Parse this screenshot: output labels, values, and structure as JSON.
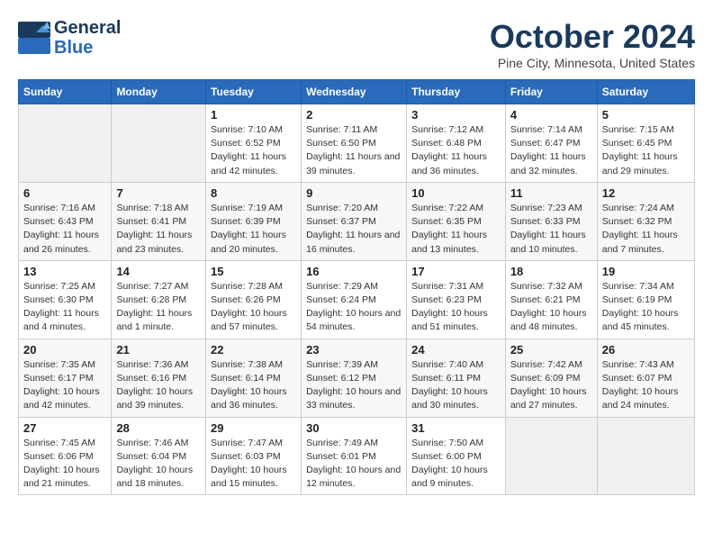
{
  "header": {
    "logo_general": "General",
    "logo_blue": "Blue",
    "month": "October 2024",
    "location": "Pine City, Minnesota, United States"
  },
  "weekdays": [
    "Sunday",
    "Monday",
    "Tuesday",
    "Wednesday",
    "Thursday",
    "Friday",
    "Saturday"
  ],
  "weeks": [
    [
      {
        "day": "",
        "empty": true
      },
      {
        "day": "",
        "empty": true
      },
      {
        "day": "1",
        "sunrise": "Sunrise: 7:10 AM",
        "sunset": "Sunset: 6:52 PM",
        "daylight": "Daylight: 11 hours and 42 minutes."
      },
      {
        "day": "2",
        "sunrise": "Sunrise: 7:11 AM",
        "sunset": "Sunset: 6:50 PM",
        "daylight": "Daylight: 11 hours and 39 minutes."
      },
      {
        "day": "3",
        "sunrise": "Sunrise: 7:12 AM",
        "sunset": "Sunset: 6:48 PM",
        "daylight": "Daylight: 11 hours and 36 minutes."
      },
      {
        "day": "4",
        "sunrise": "Sunrise: 7:14 AM",
        "sunset": "Sunset: 6:47 PM",
        "daylight": "Daylight: 11 hours and 32 minutes."
      },
      {
        "day": "5",
        "sunrise": "Sunrise: 7:15 AM",
        "sunset": "Sunset: 6:45 PM",
        "daylight": "Daylight: 11 hours and 29 minutes."
      }
    ],
    [
      {
        "day": "6",
        "sunrise": "Sunrise: 7:16 AM",
        "sunset": "Sunset: 6:43 PM",
        "daylight": "Daylight: 11 hours and 26 minutes."
      },
      {
        "day": "7",
        "sunrise": "Sunrise: 7:18 AM",
        "sunset": "Sunset: 6:41 PM",
        "daylight": "Daylight: 11 hours and 23 minutes."
      },
      {
        "day": "8",
        "sunrise": "Sunrise: 7:19 AM",
        "sunset": "Sunset: 6:39 PM",
        "daylight": "Daylight: 11 hours and 20 minutes."
      },
      {
        "day": "9",
        "sunrise": "Sunrise: 7:20 AM",
        "sunset": "Sunset: 6:37 PM",
        "daylight": "Daylight: 11 hours and 16 minutes."
      },
      {
        "day": "10",
        "sunrise": "Sunrise: 7:22 AM",
        "sunset": "Sunset: 6:35 PM",
        "daylight": "Daylight: 11 hours and 13 minutes."
      },
      {
        "day": "11",
        "sunrise": "Sunrise: 7:23 AM",
        "sunset": "Sunset: 6:33 PM",
        "daylight": "Daylight: 11 hours and 10 minutes."
      },
      {
        "day": "12",
        "sunrise": "Sunrise: 7:24 AM",
        "sunset": "Sunset: 6:32 PM",
        "daylight": "Daylight: 11 hours and 7 minutes."
      }
    ],
    [
      {
        "day": "13",
        "sunrise": "Sunrise: 7:25 AM",
        "sunset": "Sunset: 6:30 PM",
        "daylight": "Daylight: 11 hours and 4 minutes."
      },
      {
        "day": "14",
        "sunrise": "Sunrise: 7:27 AM",
        "sunset": "Sunset: 6:28 PM",
        "daylight": "Daylight: 11 hours and 1 minute."
      },
      {
        "day": "15",
        "sunrise": "Sunrise: 7:28 AM",
        "sunset": "Sunset: 6:26 PM",
        "daylight": "Daylight: 10 hours and 57 minutes."
      },
      {
        "day": "16",
        "sunrise": "Sunrise: 7:29 AM",
        "sunset": "Sunset: 6:24 PM",
        "daylight": "Daylight: 10 hours and 54 minutes."
      },
      {
        "day": "17",
        "sunrise": "Sunrise: 7:31 AM",
        "sunset": "Sunset: 6:23 PM",
        "daylight": "Daylight: 10 hours and 51 minutes."
      },
      {
        "day": "18",
        "sunrise": "Sunrise: 7:32 AM",
        "sunset": "Sunset: 6:21 PM",
        "daylight": "Daylight: 10 hours and 48 minutes."
      },
      {
        "day": "19",
        "sunrise": "Sunrise: 7:34 AM",
        "sunset": "Sunset: 6:19 PM",
        "daylight": "Daylight: 10 hours and 45 minutes."
      }
    ],
    [
      {
        "day": "20",
        "sunrise": "Sunrise: 7:35 AM",
        "sunset": "Sunset: 6:17 PM",
        "daylight": "Daylight: 10 hours and 42 minutes."
      },
      {
        "day": "21",
        "sunrise": "Sunrise: 7:36 AM",
        "sunset": "Sunset: 6:16 PM",
        "daylight": "Daylight: 10 hours and 39 minutes."
      },
      {
        "day": "22",
        "sunrise": "Sunrise: 7:38 AM",
        "sunset": "Sunset: 6:14 PM",
        "daylight": "Daylight: 10 hours and 36 minutes."
      },
      {
        "day": "23",
        "sunrise": "Sunrise: 7:39 AM",
        "sunset": "Sunset: 6:12 PM",
        "daylight": "Daylight: 10 hours and 33 minutes."
      },
      {
        "day": "24",
        "sunrise": "Sunrise: 7:40 AM",
        "sunset": "Sunset: 6:11 PM",
        "daylight": "Daylight: 10 hours and 30 minutes."
      },
      {
        "day": "25",
        "sunrise": "Sunrise: 7:42 AM",
        "sunset": "Sunset: 6:09 PM",
        "daylight": "Daylight: 10 hours and 27 minutes."
      },
      {
        "day": "26",
        "sunrise": "Sunrise: 7:43 AM",
        "sunset": "Sunset: 6:07 PM",
        "daylight": "Daylight: 10 hours and 24 minutes."
      }
    ],
    [
      {
        "day": "27",
        "sunrise": "Sunrise: 7:45 AM",
        "sunset": "Sunset: 6:06 PM",
        "daylight": "Daylight: 10 hours and 21 minutes."
      },
      {
        "day": "28",
        "sunrise": "Sunrise: 7:46 AM",
        "sunset": "Sunset: 6:04 PM",
        "daylight": "Daylight: 10 hours and 18 minutes."
      },
      {
        "day": "29",
        "sunrise": "Sunrise: 7:47 AM",
        "sunset": "Sunset: 6:03 PM",
        "daylight": "Daylight: 10 hours and 15 minutes."
      },
      {
        "day": "30",
        "sunrise": "Sunrise: 7:49 AM",
        "sunset": "Sunset: 6:01 PM",
        "daylight": "Daylight: 10 hours and 12 minutes."
      },
      {
        "day": "31",
        "sunrise": "Sunrise: 7:50 AM",
        "sunset": "Sunset: 6:00 PM",
        "daylight": "Daylight: 10 hours and 9 minutes."
      },
      {
        "day": "",
        "empty": true
      },
      {
        "day": "",
        "empty": true
      }
    ]
  ]
}
